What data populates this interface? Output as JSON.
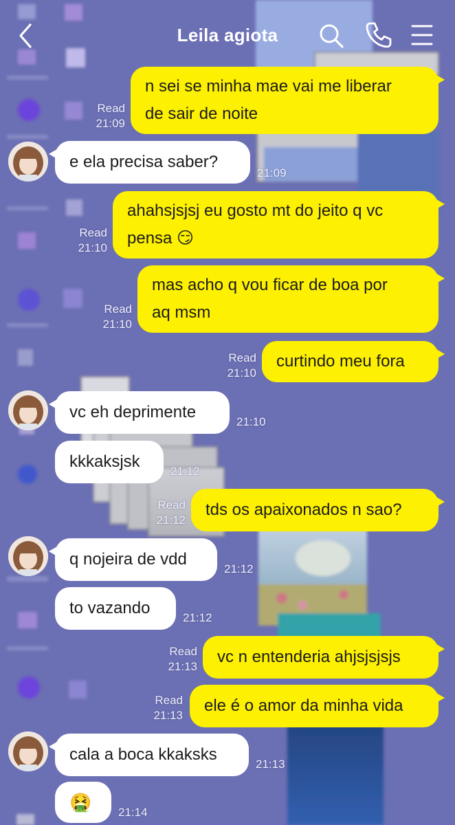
{
  "header": {
    "title": "Leila agiota",
    "back_icon": "chevron-left-icon",
    "search_icon": "search-icon",
    "call_icon": "phone-icon",
    "menu_icon": "menu-icon"
  },
  "colors": {
    "background": "#6b6fb3",
    "outgoing_bubble": "#fdf000",
    "incoming_bubble": "#ffffff",
    "meta_text": "#eef0ff"
  },
  "messages": [
    {
      "dir": "out",
      "text": "n sei se minha mae vai me liberar\nde sair de noite",
      "read": "Read",
      "time": "21:09"
    },
    {
      "dir": "in",
      "avatar": true,
      "text": "e ela precisa saber?",
      "time": "21:09"
    },
    {
      "dir": "out",
      "text": "ahahsjsjsj eu gosto mt do jeito q vc\npensa 😏",
      "read": "Read",
      "time": "21:10"
    },
    {
      "dir": "out",
      "text": "mas acho q vou ficar de boa por\naq msm",
      "read": "Read",
      "time": "21:10"
    },
    {
      "dir": "out",
      "text": "curtindo meu fora",
      "read": "Read",
      "time": "21:10"
    },
    {
      "dir": "in",
      "avatar": true,
      "text": "vc eh deprimente",
      "time": "21:10"
    },
    {
      "dir": "in",
      "avatar": false,
      "text": "kkkaksjsk",
      "time": "21:12"
    },
    {
      "dir": "out",
      "text": "tds os apaixonados n sao?",
      "read": "Read",
      "time": "21:12"
    },
    {
      "dir": "in",
      "avatar": true,
      "text": "q nojeira de vdd",
      "time": "21:12"
    },
    {
      "dir": "in",
      "avatar": false,
      "text": "to vazando",
      "time": "21:12"
    },
    {
      "dir": "out",
      "text": "vc n entenderia ahjsjsjsjs",
      "read": "Read",
      "time": "21:13"
    },
    {
      "dir": "out",
      "text": "ele é o amor da minha vida",
      "read": "Read",
      "time": "21:13"
    },
    {
      "dir": "in",
      "avatar": true,
      "text": "cala a boca kkaksks",
      "time": "21:13"
    },
    {
      "dir": "in",
      "avatar": false,
      "text": "🤮",
      "time": "21:14"
    }
  ]
}
